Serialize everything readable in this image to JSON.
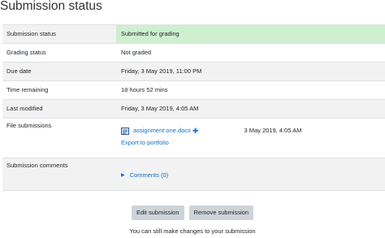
{
  "page": {
    "title": "Submission status"
  },
  "rows": [
    {
      "label": "Submission status",
      "value": "Submitted for grading"
    },
    {
      "label": "Grading status",
      "value": "Not graded"
    },
    {
      "label": "Due date",
      "value": "Friday, 3 May 2019, 11:00 PM"
    },
    {
      "label": "Time remaining",
      "value": "18 hours 52 mins"
    },
    {
      "label": "Last modified",
      "value": "Friday, 3 May 2019, 4:05 AM"
    }
  ],
  "file_submissions": {
    "label": "File submissions",
    "file_name": "assignment one.docx",
    "plus": "✚",
    "file_date": "3 May 2019, 4:05 AM",
    "export_link": "Export to portfolio"
  },
  "submission_comments": {
    "label": "Submission comments",
    "link": "Comments (0)"
  },
  "actions": {
    "edit_label": "Edit submission",
    "remove_label": "Remove submission",
    "note": "You can still make changes to your submission"
  },
  "colors": {
    "status_ok": "#cfefcf",
    "link": "#0f6fc5"
  },
  "icons": {
    "file": "document-icon",
    "comments_toggle": "triangle-right-icon"
  }
}
